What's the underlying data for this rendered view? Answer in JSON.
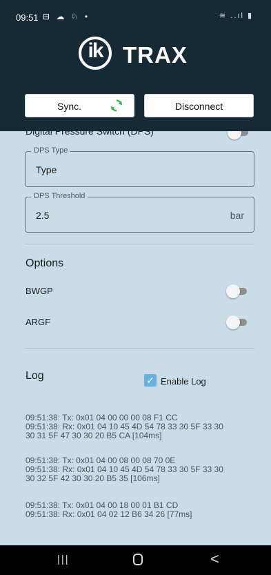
{
  "statusbar": {
    "time": "09:51",
    "left_icons": "⊟ ☁ ♘ •",
    "right_icons": "≋ ..ıl ▮"
  },
  "logo": {
    "mark": "ik",
    "text": "TRAX"
  },
  "actions": {
    "sync_label": "Sync.",
    "disconnect_label": "Disconnect",
    "sync_icon_color": "#2fbf3f"
  },
  "dps": {
    "section_label_cut": "Digital Pressure Switch (DPS)",
    "type": {
      "legend": "DPS Type",
      "value": "Type"
    },
    "threshold": {
      "legend": "DPS Threshold",
      "value": "2.5",
      "unit": "bar"
    }
  },
  "options": {
    "title": "Options",
    "items": [
      {
        "label": "BWGP",
        "enabled": false
      },
      {
        "label": "ARGF",
        "enabled": false
      }
    ]
  },
  "log": {
    "title": "Log",
    "enable_label": "Enable Log",
    "enabled": true,
    "entries": [
      "09:51:38: Tx: 0x01 04 00 00 00 08 F1 CC\n09:51:38: Rx: 0x01 04 10 45 4D 54 78 33 30 5F 33 30\n30 31 5F 47 30 30 20 B5 CA [104ms]",
      "09:51:38: Tx: 0x01 04 00 08 00 08 70 0E\n09:51:38: Rx: 0x01 04 10 45 4D 54 78 33 30 5F 33 30\n30 32 5F 42 30 30 20 B5 35 [106ms]",
      "09:51:38: Tx: 0x01 04 00 18 00 01 B1 CD\n09:51:38: Rx: 0x01 04 02 12 B6 34 26 [77ms]"
    ]
  },
  "navbar": {
    "recent": "|||",
    "back": "<"
  },
  "colors": {
    "header_bg": "#162a36",
    "content_bg": "#c9dce8",
    "checkbox": "#64b2dd"
  }
}
